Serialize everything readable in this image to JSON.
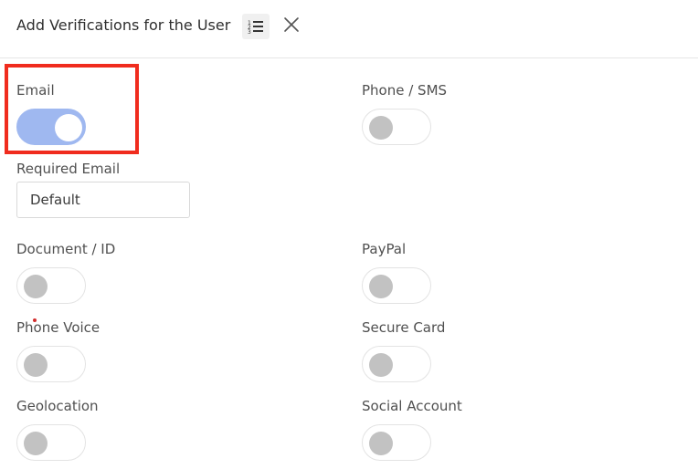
{
  "header": {
    "title": "Add Verifications for the User",
    "list_icon": "list-numbered-icon",
    "close_icon": "close-icon"
  },
  "colors": {
    "toggle_on": "#9fb8f0",
    "toggle_knob_off": "#c2c2c2",
    "highlight": "#f02c1e"
  },
  "verifications": {
    "email": {
      "label": "Email",
      "enabled": true
    },
    "phone_sms": {
      "label": "Phone / SMS",
      "enabled": false
    },
    "required_email": {
      "label": "Required Email",
      "value": "Default"
    },
    "document_id": {
      "label": "Document / ID",
      "enabled": false
    },
    "paypal": {
      "label": "PayPal",
      "enabled": false
    },
    "phone_voice": {
      "label": "Phone Voice",
      "enabled": false
    },
    "secure_card": {
      "label": "Secure Card",
      "enabled": false
    },
    "geolocation": {
      "label": "Geolocation",
      "enabled": false
    },
    "social_account": {
      "label": "Social Account",
      "enabled": false
    }
  }
}
